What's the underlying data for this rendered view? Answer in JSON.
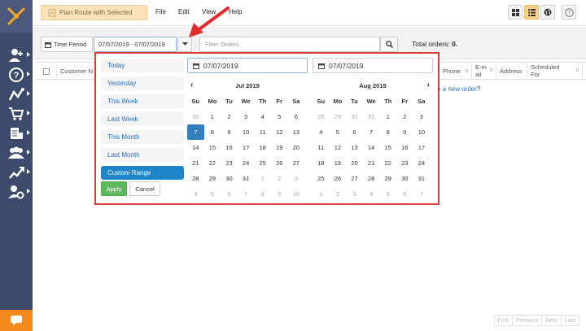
{
  "toolbar": {
    "plan_route_label": "Plan Route with Selected",
    "menu": [
      "File",
      "Edit",
      "View",
      "Help"
    ]
  },
  "filter": {
    "time_period_label": "Time Period",
    "date_range_value": "07/07/2019 - 07/07/2019",
    "search_placeholder": "Filter Orders",
    "total_label": "Total orders:",
    "total_value": "0"
  },
  "table": {
    "columns": [
      "Customer N",
      "Phone",
      "E-mail",
      "Address",
      "Scheduled For"
    ],
    "empty_text": "e a new order?",
    "empty_link_text": "e a new order"
  },
  "pagination": [
    "First",
    "Previous",
    "Next",
    "Last"
  ],
  "datepicker": {
    "ranges": [
      "Today",
      "Yesterday",
      "This Week",
      "Last Week",
      "This Month",
      "Last Month",
      "Custom Range"
    ],
    "active_range": "Custom Range",
    "apply_label": "Apply",
    "cancel_label": "Cancel",
    "start_date": "07/07/2019",
    "end_date": "07/07/2019",
    "weekdays": [
      "Su",
      "Mo",
      "Tu",
      "We",
      "Th",
      "Fr",
      "Sa"
    ],
    "left_month": {
      "title": "Jul 2019",
      "days": [
        [
          "30",
          "off"
        ],
        [
          "1",
          ""
        ],
        [
          "2",
          ""
        ],
        [
          "3",
          ""
        ],
        [
          "4",
          ""
        ],
        [
          "5",
          ""
        ],
        [
          "6",
          ""
        ],
        [
          "7",
          "sel"
        ],
        [
          "8",
          ""
        ],
        [
          "9",
          ""
        ],
        [
          "10",
          ""
        ],
        [
          "11",
          ""
        ],
        [
          "12",
          ""
        ],
        [
          "13",
          ""
        ],
        [
          "14",
          ""
        ],
        [
          "15",
          ""
        ],
        [
          "16",
          ""
        ],
        [
          "17",
          ""
        ],
        [
          "18",
          ""
        ],
        [
          "19",
          ""
        ],
        [
          "20",
          ""
        ],
        [
          "21",
          ""
        ],
        [
          "22",
          ""
        ],
        [
          "23",
          ""
        ],
        [
          "24",
          ""
        ],
        [
          "25",
          ""
        ],
        [
          "26",
          ""
        ],
        [
          "27",
          ""
        ],
        [
          "28",
          ""
        ],
        [
          "29",
          ""
        ],
        [
          "30",
          ""
        ],
        [
          "31",
          ""
        ],
        [
          "1",
          "off"
        ],
        [
          "2",
          "off"
        ],
        [
          "3",
          "off"
        ],
        [
          "4",
          "off"
        ],
        [
          "5",
          "off"
        ],
        [
          "6",
          "off"
        ],
        [
          "7",
          "off"
        ],
        [
          "8",
          "off"
        ],
        [
          "9",
          "off"
        ],
        [
          "10",
          "off"
        ]
      ]
    },
    "right_month": {
      "title": "Aug 2019",
      "days": [
        [
          "28",
          "off"
        ],
        [
          "29",
          "off"
        ],
        [
          "30",
          "off"
        ],
        [
          "31",
          "off"
        ],
        [
          "1",
          ""
        ],
        [
          "2",
          ""
        ],
        [
          "3",
          ""
        ],
        [
          "4",
          ""
        ],
        [
          "5",
          ""
        ],
        [
          "6",
          ""
        ],
        [
          "7",
          ""
        ],
        [
          "8",
          ""
        ],
        [
          "9",
          ""
        ],
        [
          "10",
          ""
        ],
        [
          "11",
          ""
        ],
        [
          "12",
          ""
        ],
        [
          "13",
          ""
        ],
        [
          "14",
          ""
        ],
        [
          "15",
          ""
        ],
        [
          "16",
          ""
        ],
        [
          "17",
          ""
        ],
        [
          "18",
          ""
        ],
        [
          "19",
          ""
        ],
        [
          "20",
          ""
        ],
        [
          "21",
          ""
        ],
        [
          "22",
          ""
        ],
        [
          "23",
          ""
        ],
        [
          "24",
          ""
        ],
        [
          "25",
          ""
        ],
        [
          "26",
          ""
        ],
        [
          "27",
          ""
        ],
        [
          "28",
          ""
        ],
        [
          "29",
          ""
        ],
        [
          "30",
          ""
        ],
        [
          "31",
          ""
        ],
        [
          "1",
          "off"
        ],
        [
          "2",
          "off"
        ],
        [
          "3",
          "off"
        ],
        [
          "4",
          "off"
        ],
        [
          "5",
          "off"
        ],
        [
          "6",
          "off"
        ],
        [
          "7",
          "off"
        ]
      ]
    }
  },
  "colors": {
    "sidebar": "#3c4a6b",
    "accent_orange": "#f28a1e",
    "highlight_red": "#e03a3a",
    "selected_blue": "#357ebd"
  }
}
